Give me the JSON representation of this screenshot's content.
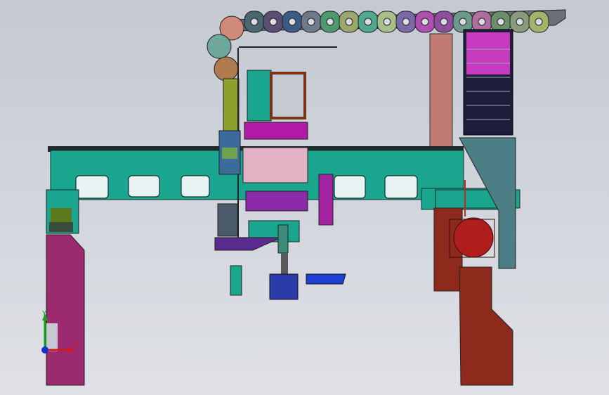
{
  "viewport": {
    "background_top": "#c4c9d2",
    "background_bottom": "#dfe1e6"
  },
  "triad": {
    "x_label": "X",
    "y_label": "Y",
    "x_color": "#d11b1b",
    "y_color": "#15a31b",
    "z_color": "#1a2fd4"
  },
  "model_colors": {
    "gantry_beam": "#1aa58e",
    "cable_chain": [
      "#cf8a7a",
      "#6fa89a",
      "#b07a4f",
      "#4a6670",
      "#5a4e77",
      "#3b5a86",
      "#6d7a8a",
      "#4d9a6e",
      "#9aa86c",
      "#4fa98c",
      "#a7c08a",
      "#7a6aa8",
      "#b04fb0",
      "#8f4f9e",
      "#6d9a8a",
      "#b06da0",
      "#6a8f6a",
      "#8a9a7a",
      "#a0b56b"
    ],
    "left_leg": "#9b2a6f",
    "right_leg": "#8e2a1c",
    "motor": "#b01d1d",
    "carriage": "#8c2aa8",
    "chain_guard": "#1e1e3c"
  }
}
